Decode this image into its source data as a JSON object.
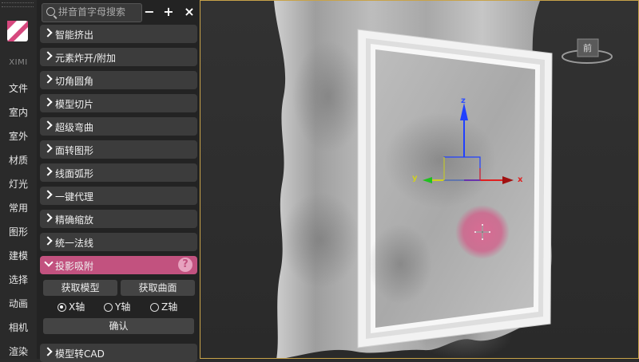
{
  "rail": {
    "brand": "XIMI",
    "items": [
      "文件",
      "室内",
      "室外",
      "材质",
      "灯光",
      "常用",
      "图形",
      "建模",
      "选择",
      "动画",
      "相机",
      "渲染"
    ]
  },
  "search": {
    "placeholder": "拼音首字母搜索"
  },
  "toolbar": {
    "collapse": "−",
    "expand": "+",
    "close": "×"
  },
  "menu": [
    "智能挤出",
    "元素炸开/附加",
    "切角圆角",
    "模型切片",
    "超级弯曲",
    "面转图形",
    "线面弧形",
    "一键代理",
    "精确缩放",
    "统一法线"
  ],
  "active_section": {
    "label": "投影吸附",
    "help": "?",
    "buttons": {
      "get_model": "获取模型",
      "get_surface": "获取曲面",
      "confirm": "确认"
    },
    "axes": [
      {
        "label": "X轴",
        "selected": true
      },
      {
        "label": "Y轴",
        "selected": false
      },
      {
        "label": "Z轴",
        "selected": false
      }
    ]
  },
  "last_item": "模型转CAD",
  "viewport": {
    "viewcube_label": "前",
    "axis_labels": {
      "x": "x",
      "y": "y",
      "z": "z"
    },
    "colors": {
      "accent": "#c2527f",
      "frame_border": "#c8a34a",
      "x_axis": "#e02020",
      "y_axis": "#20c020",
      "z_axis": "#2040ff"
    }
  }
}
